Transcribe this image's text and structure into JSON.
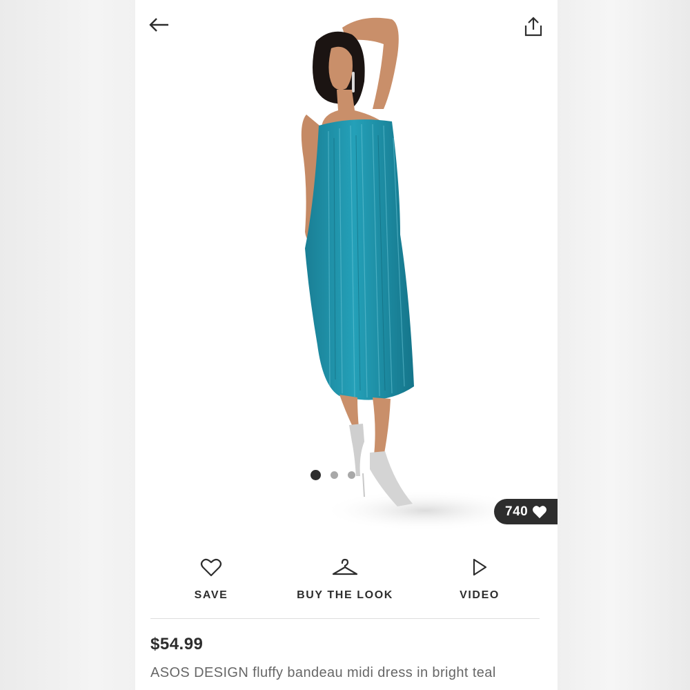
{
  "header": {
    "back_icon": "arrow-left-icon",
    "share_icon": "share-icon"
  },
  "gallery": {
    "image_count": 3,
    "active_index": 0,
    "likes": "740",
    "likes_icon": "heart-filled-icon"
  },
  "actions": [
    {
      "label": "SAVE",
      "icon": "heart-outline-icon"
    },
    {
      "label": "BUY THE LOOK",
      "icon": "hanger-icon"
    },
    {
      "label": "VIDEO",
      "icon": "play-icon"
    }
  ],
  "product": {
    "price": "$54.99",
    "title": "ASOS DESIGN fluffy bandeau midi dress in bright teal"
  },
  "colors": {
    "dress_teal": "#1d8ea6",
    "text_dark": "#2d2d2d",
    "text_muted": "#666666"
  }
}
